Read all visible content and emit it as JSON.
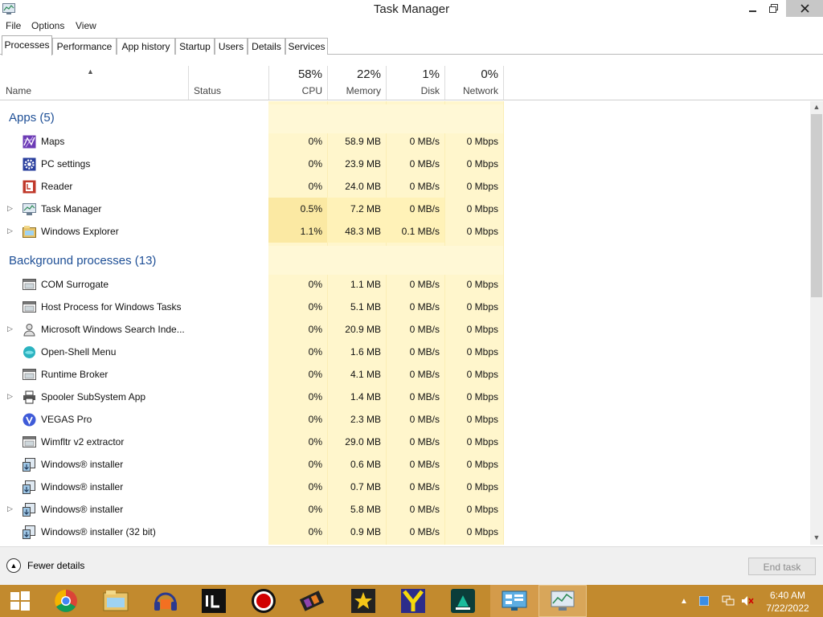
{
  "window": {
    "title": "Task Manager"
  },
  "menu": [
    "File",
    "Options",
    "View"
  ],
  "tabs": [
    "Processes",
    "Performance",
    "App history",
    "Startup",
    "Users",
    "Details",
    "Services"
  ],
  "columns": {
    "name": "Name",
    "status": "Status",
    "cpu": {
      "percent": "58%",
      "label": "CPU"
    },
    "memory": {
      "percent": "22%",
      "label": "Memory"
    },
    "disk": {
      "percent": "1%",
      "label": "Disk"
    },
    "network": {
      "percent": "0%",
      "label": "Network"
    }
  },
  "groups": {
    "apps": {
      "title": "Apps (5)",
      "rows": [
        {
          "name": "Maps",
          "cpu": "0%",
          "memory": "58.9 MB",
          "disk": "0 MB/s",
          "network": "0 Mbps",
          "expandable": false,
          "icon": "maps-icon"
        },
        {
          "name": "PC settings",
          "cpu": "0%",
          "memory": "23.9 MB",
          "disk": "0 MB/s",
          "network": "0 Mbps",
          "expandable": false,
          "icon": "gear-icon"
        },
        {
          "name": "Reader",
          "cpu": "0%",
          "memory": "24.0 MB",
          "disk": "0 MB/s",
          "network": "0 Mbps",
          "expandable": false,
          "icon": "reader-icon"
        },
        {
          "name": "Task Manager",
          "cpu": "0.5%",
          "memory": "7.2 MB",
          "disk": "0 MB/s",
          "network": "0 Mbps",
          "expandable": true,
          "icon": "task-manager-icon"
        },
        {
          "name": "Windows Explorer",
          "cpu": "1.1%",
          "memory": "48.3 MB",
          "disk": "0.1 MB/s",
          "network": "0 Mbps",
          "expandable": true,
          "icon": "folder-icon"
        }
      ]
    },
    "background": {
      "title": "Background processes (13)",
      "rows": [
        {
          "name": "COM Surrogate",
          "cpu": "0%",
          "memory": "1.1 MB",
          "disk": "0 MB/s",
          "network": "0 Mbps",
          "expandable": false,
          "icon": "window-app-icon"
        },
        {
          "name": "Host Process for Windows Tasks",
          "cpu": "0%",
          "memory": "5.1 MB",
          "disk": "0 MB/s",
          "network": "0 Mbps",
          "expandable": false,
          "icon": "window-app-icon"
        },
        {
          "name": "Microsoft Windows Search Inde...",
          "cpu": "0%",
          "memory": "20.9 MB",
          "disk": "0 MB/s",
          "network": "0 Mbps",
          "expandable": true,
          "icon": "search-user-icon"
        },
        {
          "name": "Open-Shell Menu",
          "cpu": "0%",
          "memory": "1.6 MB",
          "disk": "0 MB/s",
          "network": "0 Mbps",
          "expandable": false,
          "icon": "shell-icon"
        },
        {
          "name": "Runtime Broker",
          "cpu": "0%",
          "memory": "4.1 MB",
          "disk": "0 MB/s",
          "network": "0 Mbps",
          "expandable": false,
          "icon": "window-app-icon"
        },
        {
          "name": "Spooler SubSystem App",
          "cpu": "0%",
          "memory": "1.4 MB",
          "disk": "0 MB/s",
          "network": "0 Mbps",
          "expandable": true,
          "icon": "printer-icon"
        },
        {
          "name": "VEGAS Pro",
          "cpu": "0%",
          "memory": "2.3 MB",
          "disk": "0 MB/s",
          "network": "0 Mbps",
          "expandable": false,
          "icon": "vegas-icon"
        },
        {
          "name": "Wimfltr v2 extractor",
          "cpu": "0%",
          "memory": "29.0 MB",
          "disk": "0 MB/s",
          "network": "0 Mbps",
          "expandable": false,
          "icon": "window-app-icon"
        },
        {
          "name": "Windows® installer",
          "cpu": "0%",
          "memory": "0.6 MB",
          "disk": "0 MB/s",
          "network": "0 Mbps",
          "expandable": false,
          "icon": "installer-icon"
        },
        {
          "name": "Windows® installer",
          "cpu": "0%",
          "memory": "0.7 MB",
          "disk": "0 MB/s",
          "network": "0 Mbps",
          "expandable": false,
          "icon": "installer-icon"
        },
        {
          "name": "Windows® installer",
          "cpu": "0%",
          "memory": "5.8 MB",
          "disk": "0 MB/s",
          "network": "0 Mbps",
          "expandable": true,
          "icon": "installer-icon"
        },
        {
          "name": "Windows® installer (32 bit)",
          "cpu": "0%",
          "memory": "0.9 MB",
          "disk": "0 MB/s",
          "network": "0 Mbps",
          "expandable": false,
          "icon": "installer-icon"
        }
      ]
    }
  },
  "footer": {
    "fewer_details": "Fewer details",
    "end_task": "End task"
  },
  "taskbar": {
    "items": [
      "start-icon",
      "chrome-icon",
      "file-explorer-icon",
      "audacity-icon",
      "intellij-icon",
      "obs-record-icon",
      "film-icon",
      "star-movie-icon",
      "y-app-icon",
      "filmora-icon",
      "control-panel-icon",
      "task-manager-icon"
    ],
    "time": "6:40 AM",
    "date": "7/22/2022"
  },
  "colors": {
    "heat_light": "#fff8d6",
    "heat_mid": "#fff2b8",
    "heat_strong": "#fbe9a3",
    "group_title": "#1e4f96",
    "taskbar": "#c28a2e"
  }
}
